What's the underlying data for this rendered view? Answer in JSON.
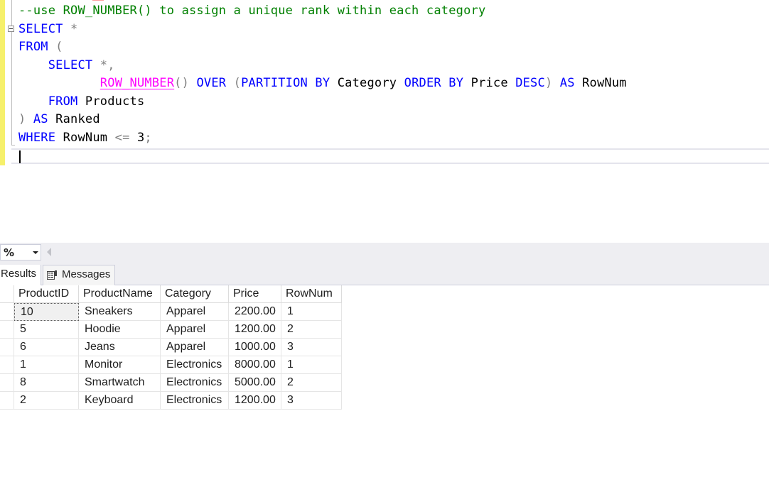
{
  "editor": {
    "lines": [
      [
        {
          "t": "--use ROW_NUMBER() to assign a unique rank within each category",
          "c": "cm"
        }
      ],
      [
        {
          "t": "SELECT",
          "c": "kw"
        },
        {
          "t": " *",
          "c": "op"
        }
      ],
      [
        {
          "t": "FROM",
          "c": "kw"
        },
        {
          "t": " (",
          "c": "op"
        }
      ],
      [
        {
          "t": "    ",
          "c": "id"
        },
        {
          "t": "SELECT",
          "c": "kw"
        },
        {
          "t": " *,",
          "c": "op"
        }
      ],
      [
        {
          "t": "           ",
          "c": "id"
        },
        {
          "t": "ROW_NUMBER",
          "c": "fn"
        },
        {
          "t": "()",
          "c": "op"
        },
        {
          "t": " OVER ",
          "c": "kw"
        },
        {
          "t": "(",
          "c": "op"
        },
        {
          "t": "PARTITION BY",
          "c": "kw"
        },
        {
          "t": " Category ",
          "c": "id"
        },
        {
          "t": "ORDER BY",
          "c": "kw"
        },
        {
          "t": " Price ",
          "c": "id"
        },
        {
          "t": "DESC",
          "c": "kw"
        },
        {
          "t": ")",
          "c": "op"
        },
        {
          "t": " AS",
          "c": "kw"
        },
        {
          "t": " RowNum",
          "c": "id"
        }
      ],
      [
        {
          "t": "    ",
          "c": "id"
        },
        {
          "t": "FROM",
          "c": "kw"
        },
        {
          "t": " Products",
          "c": "id"
        }
      ],
      [
        {
          "t": ")",
          "c": "op"
        },
        {
          "t": " AS",
          "c": "kw"
        },
        {
          "t": " Ranked",
          "c": "id"
        }
      ],
      [
        {
          "t": "WHERE",
          "c": "kw"
        },
        {
          "t": " RowNum ",
          "c": "id"
        },
        {
          "t": "<=",
          "c": "op"
        },
        {
          "t": " 3",
          "c": "id"
        },
        {
          "t": ";",
          "c": "op"
        }
      ]
    ]
  },
  "zoom": {
    "value": "%"
  },
  "tabs": {
    "results": "Results",
    "messages": "Messages"
  },
  "grid": {
    "columns": [
      "ProductID",
      "ProductName",
      "Category",
      "Price",
      "RowNum"
    ],
    "rows": [
      [
        "10",
        "Sneakers",
        "Apparel",
        "2200.00",
        "1"
      ],
      [
        "5",
        "Hoodie",
        "Apparel",
        "1200.00",
        "2"
      ],
      [
        "6",
        "Jeans",
        "Apparel",
        "1000.00",
        "3"
      ],
      [
        "1",
        "Monitor",
        "Electronics",
        "8000.00",
        "1"
      ],
      [
        "8",
        "Smartwatch",
        "Electronics",
        "5000.00",
        "2"
      ],
      [
        "2",
        "Keyboard",
        "Electronics",
        "1200.00",
        "3"
      ]
    ]
  },
  "colors": {
    "keyword": "#0000ff",
    "comment": "#008000",
    "function": "#ff00ff",
    "operator": "#808080",
    "change_bar": "#f6f06b"
  },
  "icons": {
    "messages_tab": "messages-icon",
    "collapse": "collapse-minus-icon",
    "zoom_dropdown": "chevron-down-icon"
  }
}
